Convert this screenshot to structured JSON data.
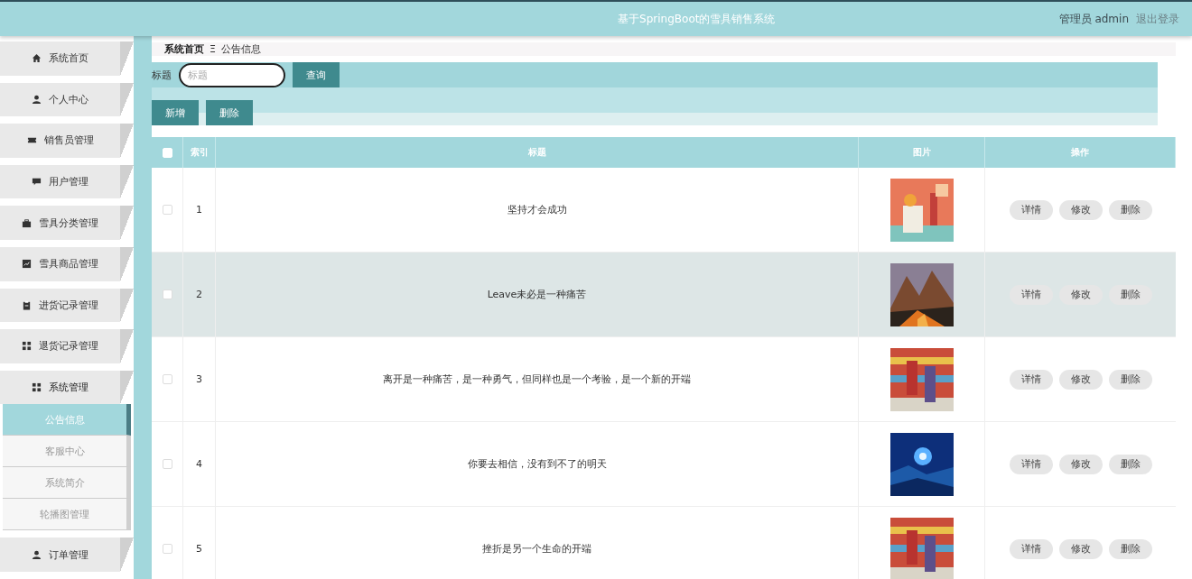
{
  "header": {
    "title": "基于SpringBoot的雪具销售系统",
    "user": "管理员 admin",
    "logout": "退出登录"
  },
  "sidebar": {
    "items": [
      {
        "label": "系统首页",
        "expanded": false
      },
      {
        "label": "个人中心",
        "expanded": false
      },
      {
        "label": "销售员管理",
        "expanded": false
      },
      {
        "label": "用户管理",
        "expanded": false
      },
      {
        "label": "雪具分类管理",
        "expanded": false
      },
      {
        "label": "雪具商品管理",
        "expanded": false
      },
      {
        "label": "进货记录管理",
        "expanded": false
      },
      {
        "label": "退货记录管理",
        "expanded": false
      },
      {
        "label": "系统管理",
        "expanded": true,
        "children": [
          {
            "label": "公告信息",
            "selected": true
          },
          {
            "label": "客服中心",
            "selected": false
          },
          {
            "label": "系统简介",
            "selected": false
          },
          {
            "label": "轮播图管理",
            "selected": false
          }
        ]
      },
      {
        "label": "订单管理",
        "expanded": false
      }
    ]
  },
  "breadcrumb": {
    "home": "系统首页",
    "separator": "Ξ",
    "current": "公告信息"
  },
  "search": {
    "label": "标题",
    "placeholder": "标题",
    "button": "查询"
  },
  "actions": [
    "新增",
    "删除"
  ],
  "table": {
    "select_all_checked": false,
    "columns": [
      "索引",
      "标题",
      "图片",
      "操作"
    ],
    "rows": [
      {
        "index": "1",
        "title": "坚持才会成功",
        "checked": false,
        "hovered": false,
        "buttons": [
          "详情",
          "修改",
          "删除"
        ]
      },
      {
        "index": "2",
        "title": "Leave未必是一种痛苦",
        "checked": false,
        "hovered": true,
        "buttons": [
          "详情",
          "修改",
          "删除"
        ]
      },
      {
        "index": "3",
        "title": "离开是一种痛苦，是一种勇气，但同样也是一个考验，是一个新的开端",
        "checked": false,
        "hovered": false,
        "buttons": [
          "详情",
          "修改",
          "删除"
        ]
      },
      {
        "index": "4",
        "title": "你要去相信，没有到不了的明天",
        "checked": false,
        "hovered": false,
        "buttons": [
          "详情",
          "修改",
          "删除"
        ]
      },
      {
        "index": "5",
        "title": "挫折是另一个生命的开端",
        "checked": false,
        "hovered": false,
        "buttons": [
          "详情",
          "修改",
          "删除"
        ]
      }
    ]
  }
}
